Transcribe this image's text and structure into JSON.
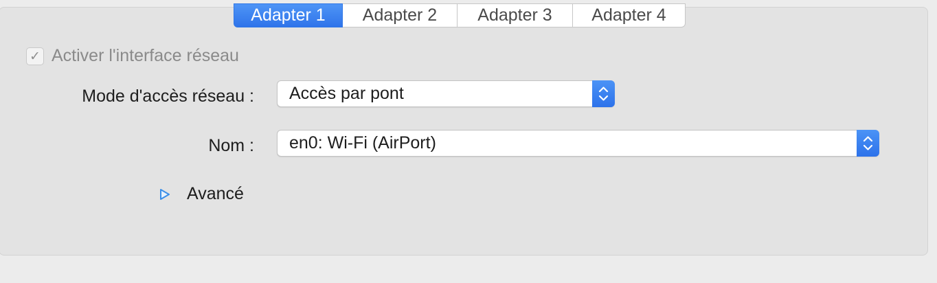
{
  "tabs": [
    {
      "label": "Adapter 1",
      "active": true
    },
    {
      "label": "Adapter 2",
      "active": false
    },
    {
      "label": "Adapter 3",
      "active": false
    },
    {
      "label": "Adapter 4",
      "active": false
    }
  ],
  "enable_interface": {
    "label": "Activer l'interface réseau",
    "checked": true,
    "check_glyph": "✓"
  },
  "network_mode": {
    "label": "Mode d'accès réseau :",
    "value": "Accès par pont"
  },
  "name": {
    "label": "Nom :",
    "value": "en0: Wi-Fi (AirPort)"
  },
  "advanced": {
    "label": "Avancé",
    "icon": "disclosure-triangle-right-icon"
  },
  "colors": {
    "accent": "#2f74ea",
    "panel_bg": "#e3e3e3",
    "window_bg": "#ececec"
  }
}
